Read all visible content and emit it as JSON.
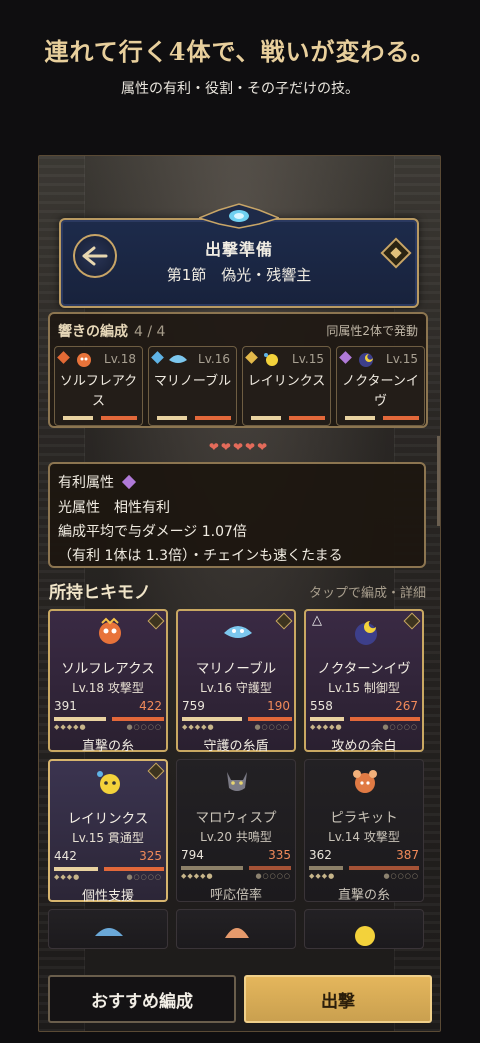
{
  "hero": {
    "title": "連れて行く4体で、戦いが変わる。",
    "subtitle": "属性の有利・役割・その子だけの技。"
  },
  "header": {
    "title": "出撃準備",
    "stage": "第1節　偽光・残響主"
  },
  "team": {
    "label": "響きの編成",
    "count": "4 / 4",
    "note": "同属性2体で発動",
    "members": [
      {
        "name": "ソルフレアクス",
        "level": "Lv.18",
        "element_color": "#e36a35"
      },
      {
        "name": "マリノーブル",
        "level": "Lv.16",
        "element_color": "#5fb3e6"
      },
      {
        "name": "レイリンクス",
        "level": "Lv.15",
        "element_color": "#e3b94a"
      },
      {
        "name": "ノクターンイヴ",
        "level": "Lv.15",
        "element_color": "#b07ad8"
      }
    ]
  },
  "hearts": "❤❤❤❤❤",
  "advantage": {
    "title": "有利属性",
    "line1": "光属性　相性有利",
    "line2": "編成平均で与ダメージ 1.07倍",
    "line3": "（有利 1体は 1.3倍）・チェインも速くたまる"
  },
  "roster": {
    "title": "所持ヒキモノ",
    "note": "タップで編成・詳細",
    "cards": [
      {
        "name": "ソルフレアクス",
        "level": "Lv.18 攻撃型",
        "hp": "391",
        "atk": "422",
        "skill": "直撃の糸",
        "state": "in-team"
      },
      {
        "name": "マリノーブル",
        "level": "Lv.16 守護型",
        "hp": "759",
        "atk": "190",
        "skill": "守護の糸盾",
        "state": "in-team"
      },
      {
        "name": "ノクターンイヴ",
        "level": "Lv.15 制御型",
        "hp": "558",
        "atk": "267",
        "skill": "攻めの余白",
        "state": "in-team"
      },
      {
        "name": "レイリンクス",
        "level": "Lv.15 貫通型",
        "hp": "442",
        "atk": "325",
        "skill": "個性支援",
        "state": "selected"
      },
      {
        "name": "マロウィスプ",
        "level": "Lv.20 共鳴型",
        "hp": "794",
        "atk": "335",
        "skill": "呼応倍率",
        "state": "available"
      },
      {
        "name": "ピラキット",
        "level": "Lv.14 攻撃型",
        "hp": "362",
        "atk": "387",
        "skill": "直撃の糸",
        "state": "available"
      }
    ]
  },
  "actions": {
    "recommend": "おすすめ編成",
    "sortie": "出撃"
  }
}
